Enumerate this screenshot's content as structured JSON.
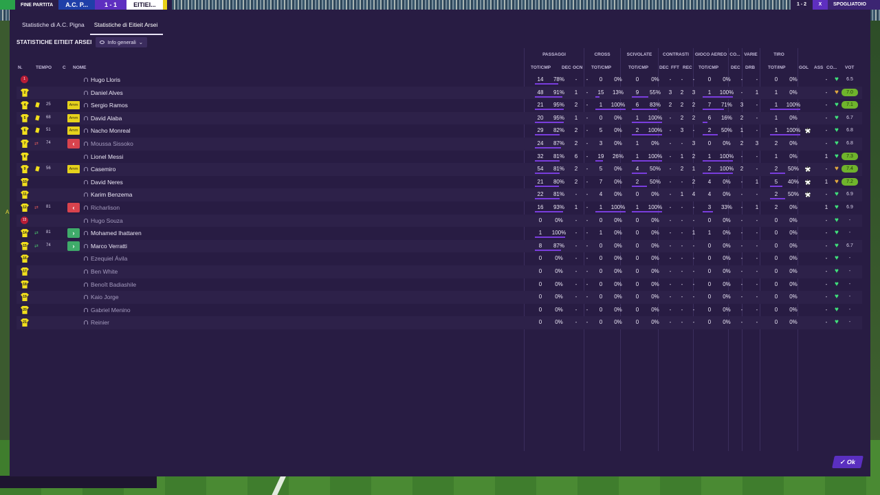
{
  "topbar": {
    "end_label": "FINE PARTITA",
    "team_left": "A.C. P...",
    "score": "1 - 1",
    "team_right": "EITIEI...",
    "right_score": "1 - 2",
    "right_x": "X",
    "right_label": "SPOGLIATOIO"
  },
  "tabs": [
    {
      "label": "Statistiche di A.C. Pigna",
      "active": false
    },
    {
      "label": "Statistiche di Eitieit Arsei",
      "active": true
    }
  ],
  "section_title": "STATISTICHE EITIEIT ARSEI",
  "dropdown_label": "Info generali",
  "groups": {
    "passaggi": "PASSAGGI",
    "cross": "CROSS",
    "scivolate": "SCIVOLATE",
    "contrasti": "CONTRASTI",
    "gioco_aereo": "GIOCO AEREO",
    "co": "CO...",
    "varie": "VARIE",
    "tiro": "TIRO"
  },
  "columns": {
    "n": "N.",
    "tempo": "TEMPO",
    "c": "C",
    "nome": "NOME",
    "pass_totcmp": "TOT/CMP",
    "dec": "DEC",
    "ocn": "OCN",
    "cross_totcmp": "TOT/CMP",
    "sciv_totcmp": "TOT/CMP",
    "con_dec": "DEC",
    "con_fft": "FFT",
    "con_rec": "REC",
    "aereo_totcmp": "TOT/CMP",
    "co_dec": "DEC",
    "drb": "DRB",
    "tiro_totinp": "TOT/INP",
    "gol": "GOL",
    "ass": "ASS",
    "cond": "CO...",
    "vot": "VOT"
  },
  "players": [
    {
      "num": "1",
      "gk": true,
      "name": "Hugo Lloris",
      "pass": [
        "14",
        "78%"
      ],
      "dec": "-",
      "ocn": "-",
      "cross": [
        "0",
        "0%"
      ],
      "sciv": [
        "0",
        "0%"
      ],
      "cdec": "-",
      "fft": "-",
      "rec": "-",
      "aer": [
        "0",
        "0%"
      ],
      "codec": "-",
      "drb": "-",
      "tiro": [
        "0",
        "0%"
      ],
      "gol": "",
      "ass": "-",
      "heart": "green",
      "vot": "6.5",
      "good": false
    },
    {
      "num": "2",
      "name": "Daniel Alves",
      "pass": [
        "48",
        "91%"
      ],
      "dec": "1",
      "ocn": "-",
      "cross": [
        "15",
        "13%"
      ],
      "sciv": [
        "9",
        "55%"
      ],
      "cdec": "3",
      "fft": "2",
      "rec": "3",
      "aer": [
        "1",
        "100%"
      ],
      "codec": "-",
      "drb": "1",
      "tiro": [
        "1",
        "0%"
      ],
      "gol": "",
      "ass": "-",
      "heart": "amber",
      "vot": "7.0",
      "good": true
    },
    {
      "num": "4",
      "card": "y",
      "minute": "25",
      "amm": "Amm",
      "name": "Sergio Ramos",
      "pass": [
        "21",
        "95%"
      ],
      "dec": "2",
      "ocn": "-",
      "cross": [
        "1",
        "100%"
      ],
      "sciv": [
        "6",
        "83%"
      ],
      "cdec": "2",
      "fft": "2",
      "rec": "2",
      "aer": [
        "7",
        "71%"
      ],
      "codec": "3",
      "drb": "-",
      "tiro": [
        "1",
        "100%"
      ],
      "gol": "",
      "ass": "-",
      "heart": "green",
      "vot": "7.1",
      "good": true
    },
    {
      "num": "5",
      "card": "y",
      "minute": "68",
      "amm": "Amm",
      "name": "David Alaba",
      "pass": [
        "20",
        "95%"
      ],
      "dec": "1",
      "ocn": "-",
      "cross": [
        "0",
        "0%"
      ],
      "sciv": [
        "1",
        "100%"
      ],
      "cdec": "-",
      "fft": "2",
      "rec": "2",
      "aer": [
        "6",
        "16%"
      ],
      "codec": "2",
      "drb": "-",
      "tiro": [
        "1",
        "0%"
      ],
      "gol": "",
      "ass": "-",
      "heart": "green",
      "vot": "6.7",
      "good": false
    },
    {
      "num": "6",
      "card": "y",
      "minute": "51",
      "amm": "Amm",
      "name": "Nacho Monreal",
      "pass": [
        "29",
        "82%"
      ],
      "dec": "2",
      "ocn": "-",
      "cross": [
        "5",
        "0%"
      ],
      "sciv": [
        "2",
        "100%"
      ],
      "cdec": "-",
      "fft": "3",
      "rec": "-",
      "aer": [
        "2",
        "50%"
      ],
      "codec": "1",
      "drb": "-",
      "tiro": [
        "1",
        "100%"
      ],
      "gol": "ball",
      "ass": "-",
      "heart": "green",
      "vot": "6.8",
      "good": false
    },
    {
      "num": "7",
      "sub": "out",
      "minute": "74",
      "name": "Moussa Sissoko",
      "dim": true,
      "pass": [
        "24",
        "87%"
      ],
      "dec": "2",
      "ocn": "-",
      "cross": [
        "3",
        "0%"
      ],
      "sciv": [
        "1",
        "0%"
      ],
      "cdec": "-",
      "fft": "-",
      "rec": "3",
      "aer": [
        "0",
        "0%"
      ],
      "codec": "2",
      "drb": "3",
      "tiro": [
        "2",
        "0%"
      ],
      "gol": "",
      "ass": "-",
      "heart": "green",
      "vot": "6.8",
      "good": false
    },
    {
      "num": "8",
      "name": "Lionel Messi",
      "pass": [
        "32",
        "81%"
      ],
      "dec": "6",
      "ocn": "-",
      "cross": [
        "19",
        "26%"
      ],
      "sciv": [
        "1",
        "100%"
      ],
      "cdec": "-",
      "fft": "1",
      "rec": "2",
      "aer": [
        "1",
        "100%"
      ],
      "codec": "-",
      "drb": "-",
      "tiro": [
        "1",
        "0%"
      ],
      "gol": "",
      "ass": "1",
      "heart": "green",
      "vot": "7.3",
      "good": true
    },
    {
      "num": "9",
      "card": "y",
      "minute": "56",
      "amm": "Amm",
      "name": "Casemiro",
      "pass": [
        "54",
        "81%"
      ],
      "dec": "2",
      "ocn": "-",
      "cross": [
        "5",
        "0%"
      ],
      "sciv": [
        "4",
        "50%"
      ],
      "cdec": "-",
      "fft": "2",
      "rec": "1",
      "aer": [
        "2",
        "100%"
      ],
      "codec": "2",
      "drb": "-",
      "tiro": [
        "2",
        "50%"
      ],
      "gol": "ball",
      "ass": "-",
      "heart": "amber",
      "vot": "7.4",
      "good": true
    },
    {
      "num": "10",
      "name": "David Neres",
      "pass": [
        "21",
        "80%"
      ],
      "dec": "2",
      "ocn": "-",
      "cross": [
        "7",
        "0%"
      ],
      "sciv": [
        "2",
        "50%"
      ],
      "cdec": "-",
      "fft": "-",
      "rec": "2",
      "aer": [
        "4",
        "0%"
      ],
      "codec": "-",
      "drb": "1",
      "tiro": [
        "5",
        "40%"
      ],
      "gol": "ball",
      "ass": "1",
      "heart": "amber",
      "vot": "7.2",
      "good": true
    },
    {
      "num": "11",
      "name": "Karim Benzema",
      "pass": [
        "22",
        "81%"
      ],
      "dec": "-",
      "ocn": "-",
      "cross": [
        "4",
        "0%"
      ],
      "sciv": [
        "0",
        "0%"
      ],
      "cdec": "-",
      "fft": "1",
      "rec": "4",
      "aer": [
        "4",
        "0%"
      ],
      "codec": "-",
      "drb": "-",
      "tiro": [
        "2",
        "50%"
      ],
      "gol": "ball",
      "ass": "-",
      "heart": "green",
      "vot": "6.9",
      "good": false
    },
    {
      "num": "12",
      "sub": "out",
      "minute": "81",
      "name": "Richarlison",
      "dim": true,
      "pass": [
        "16",
        "93%"
      ],
      "dec": "1",
      "ocn": "-",
      "cross": [
        "1",
        "100%"
      ],
      "sciv": [
        "1",
        "100%"
      ],
      "cdec": "-",
      "fft": "-",
      "rec": "-",
      "aer": [
        "3",
        "33%"
      ],
      "codec": "-",
      "drb": "1",
      "tiro": [
        "2",
        "0%"
      ],
      "gol": "",
      "ass": "1",
      "heart": "green",
      "vot": "6.9",
      "good": false
    },
    {
      "num": "13",
      "gk": true,
      "name": "Hugo Souza",
      "dim": true,
      "pass": [
        "0",
        "0%"
      ],
      "dec": "-",
      "ocn": "-",
      "cross": [
        "0",
        "0%"
      ],
      "sciv": [
        "0",
        "0%"
      ],
      "cdec": "-",
      "fft": "-",
      "rec": "-",
      "aer": [
        "0",
        "0%"
      ],
      "codec": "-",
      "drb": "-",
      "tiro": [
        "0",
        "0%"
      ],
      "gol": "",
      "ass": "-",
      "heart": "green",
      "vot": "-",
      "good": false
    },
    {
      "num": "14",
      "sub": "in",
      "minute": "81",
      "name": "Mohamed Ihattaren",
      "pass": [
        "1",
        "100%"
      ],
      "dec": "-",
      "ocn": "-",
      "cross": [
        "1",
        "0%"
      ],
      "sciv": [
        "0",
        "0%"
      ],
      "cdec": "-",
      "fft": "-",
      "rec": "1",
      "aer": [
        "1",
        "0%"
      ],
      "codec": "-",
      "drb": "-",
      "tiro": [
        "0",
        "0%"
      ],
      "gol": "",
      "ass": "-",
      "heart": "green",
      "vot": "-",
      "good": false
    },
    {
      "num": "15",
      "sub": "in",
      "minute": "74",
      "name": "Marco Verratti",
      "pass": [
        "8",
        "87%"
      ],
      "dec": "-",
      "ocn": "-",
      "cross": [
        "0",
        "0%"
      ],
      "sciv": [
        "0",
        "0%"
      ],
      "cdec": "-",
      "fft": "-",
      "rec": "-",
      "aer": [
        "0",
        "0%"
      ],
      "codec": "-",
      "drb": "-",
      "tiro": [
        "0",
        "0%"
      ],
      "gol": "",
      "ass": "-",
      "heart": "green",
      "vot": "6.7",
      "good": false
    },
    {
      "num": "16",
      "name": "Ezequiel Ávila",
      "dim": true,
      "pass": [
        "0",
        "0%"
      ],
      "dec": "-",
      "ocn": "-",
      "cross": [
        "0",
        "0%"
      ],
      "sciv": [
        "0",
        "0%"
      ],
      "cdec": "-",
      "fft": "-",
      "rec": "-",
      "aer": [
        "0",
        "0%"
      ],
      "codec": "-",
      "drb": "-",
      "tiro": [
        "0",
        "0%"
      ],
      "gol": "",
      "ass": "-",
      "heart": "green",
      "vot": "-",
      "good": false
    },
    {
      "num": "17",
      "name": "Ben White",
      "dim": true,
      "pass": [
        "0",
        "0%"
      ],
      "dec": "-",
      "ocn": "-",
      "cross": [
        "0",
        "0%"
      ],
      "sciv": [
        "0",
        "0%"
      ],
      "cdec": "-",
      "fft": "-",
      "rec": "-",
      "aer": [
        "0",
        "0%"
      ],
      "codec": "-",
      "drb": "-",
      "tiro": [
        "0",
        "0%"
      ],
      "gol": "",
      "ass": "-",
      "heart": "green",
      "vot": "-",
      "good": false
    },
    {
      "num": "18",
      "name": "Benoît Badiashile",
      "dim": true,
      "pass": [
        "0",
        "0%"
      ],
      "dec": "-",
      "ocn": "-",
      "cross": [
        "0",
        "0%"
      ],
      "sciv": [
        "0",
        "0%"
      ],
      "cdec": "-",
      "fft": "-",
      "rec": "-",
      "aer": [
        "0",
        "0%"
      ],
      "codec": "-",
      "drb": "-",
      "tiro": [
        "0",
        "0%"
      ],
      "gol": "",
      "ass": "-",
      "heart": "green",
      "vot": "-",
      "good": false
    },
    {
      "num": "19",
      "name": "Kaio Jorge",
      "dim": true,
      "pass": [
        "0",
        "0%"
      ],
      "dec": "-",
      "ocn": "-",
      "cross": [
        "0",
        "0%"
      ],
      "sciv": [
        "0",
        "0%"
      ],
      "cdec": "-",
      "fft": "-",
      "rec": "-",
      "aer": [
        "0",
        "0%"
      ],
      "codec": "-",
      "drb": "-",
      "tiro": [
        "0",
        "0%"
      ],
      "gol": "",
      "ass": "-",
      "heart": "green",
      "vot": "-",
      "good": false
    },
    {
      "num": "20",
      "name": "Gabriel Menino",
      "dim": true,
      "pass": [
        "0",
        "0%"
      ],
      "dec": "-",
      "ocn": "-",
      "cross": [
        "0",
        "0%"
      ],
      "sciv": [
        "0",
        "0%"
      ],
      "cdec": "-",
      "fft": "-",
      "rec": "-",
      "aer": [
        "0",
        "0%"
      ],
      "codec": "-",
      "drb": "-",
      "tiro": [
        "0",
        "0%"
      ],
      "gol": "",
      "ass": "-",
      "heart": "green",
      "vot": "-",
      "good": false
    },
    {
      "num": "21",
      "name": "Reinier",
      "dim": true,
      "pass": [
        "0",
        "0%"
      ],
      "dec": "-",
      "ocn": "-",
      "cross": [
        "0",
        "0%"
      ],
      "sciv": [
        "0",
        "0%"
      ],
      "cdec": "-",
      "fft": "-",
      "rec": "-",
      "aer": [
        "0",
        "0%"
      ],
      "codec": "-",
      "drb": "-",
      "tiro": [
        "0",
        "0%"
      ],
      "gol": "",
      "ass": "-",
      "heart": "green",
      "vot": "-",
      "good": false
    }
  ],
  "ok_label": "Ok",
  "side_marker": "A"
}
